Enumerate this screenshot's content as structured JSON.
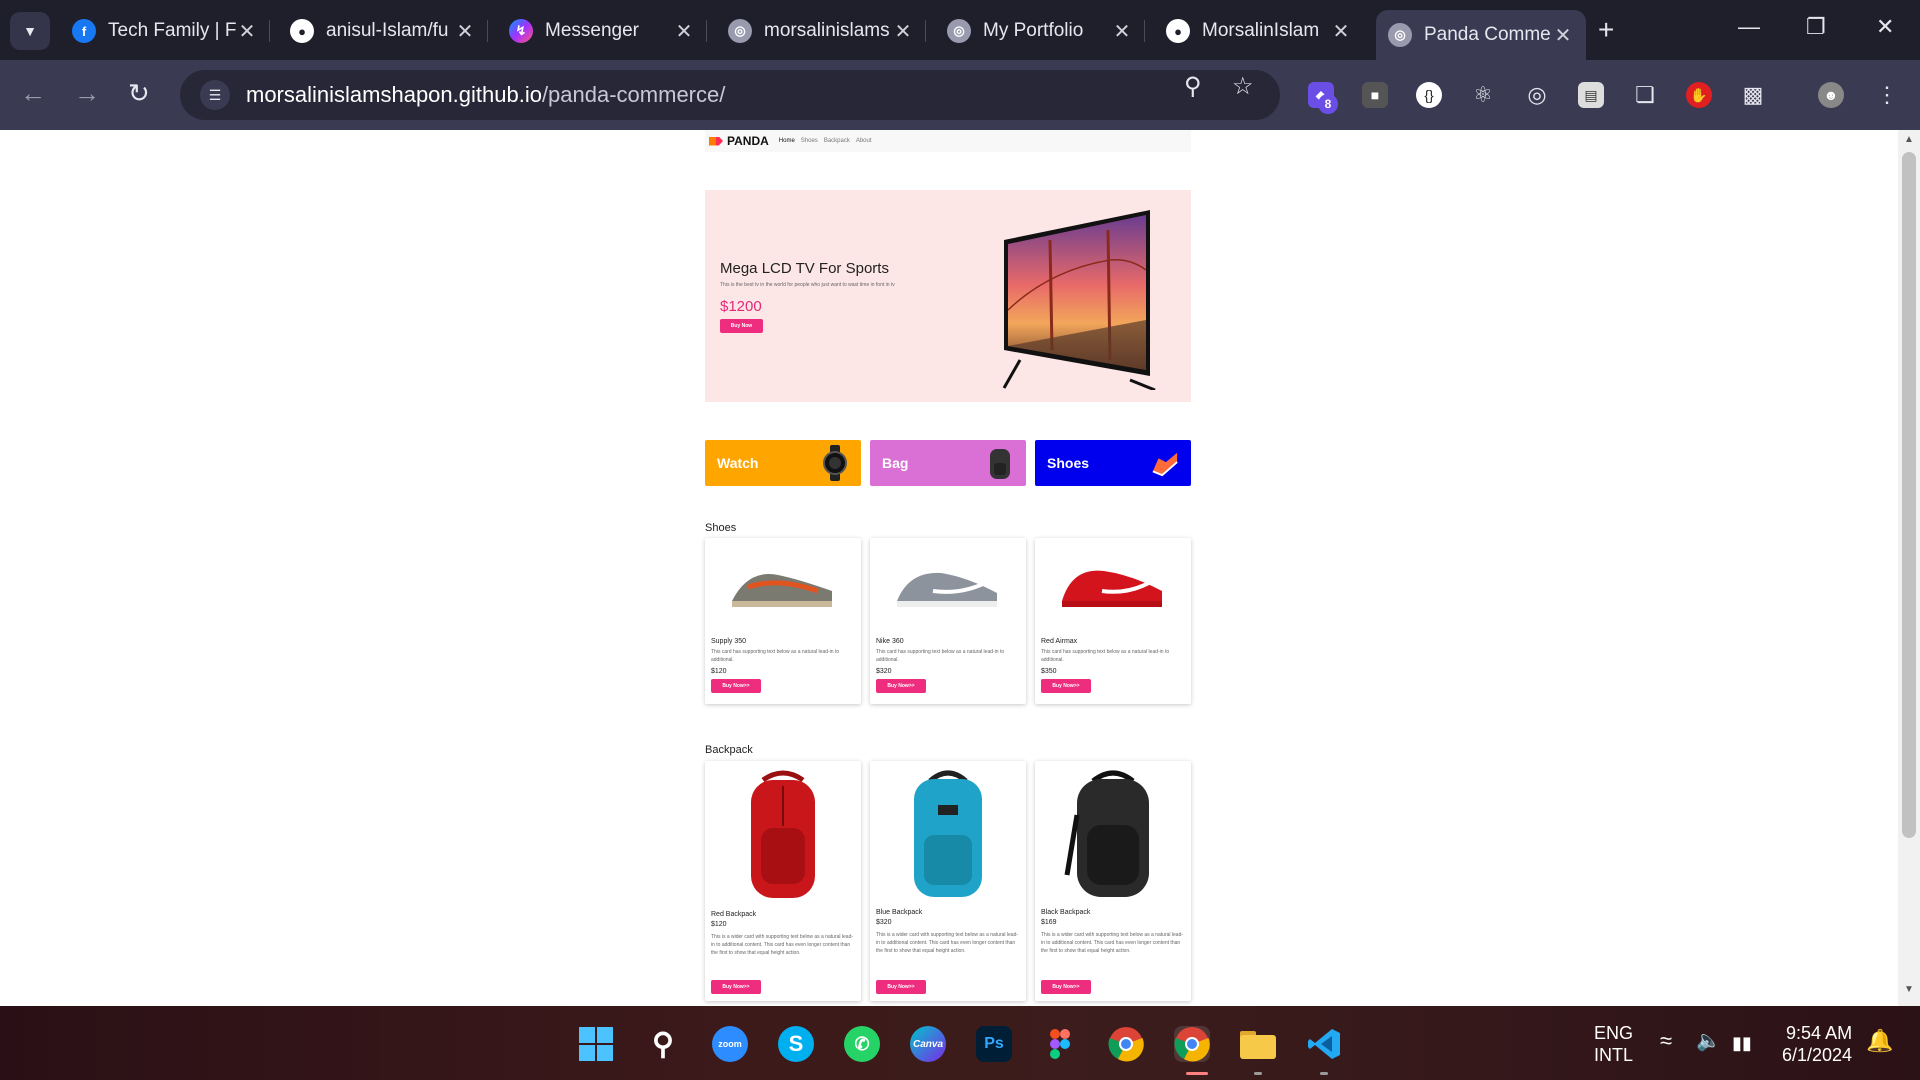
{
  "browser": {
    "tabs": [
      {
        "title": "Tech Family | F",
        "icon": "facebook-icon",
        "color": "#1877f2"
      },
      {
        "title": "anisul-Islam/fu",
        "icon": "github-icon",
        "color": "#ffffff"
      },
      {
        "title": "Messenger",
        "icon": "messenger-icon",
        "color": "#a033ff"
      },
      {
        "title": "morsalinislams",
        "icon": "globe-icon",
        "color": "#9a9aae"
      },
      {
        "title": "My Portfolio",
        "icon": "globe-icon",
        "color": "#9a9aae"
      },
      {
        "title": "MorsalinIslam",
        "icon": "github-icon",
        "color": "#ffffff"
      },
      {
        "title": "Panda Comme",
        "icon": "globe-icon",
        "color": "#9a9aae"
      }
    ],
    "url_domain": "morsalinislamshapon.github.io",
    "url_path": "/panda-commerce/",
    "extension_badge": "8"
  },
  "site": {
    "logo": "PANDA",
    "nav": [
      "Home",
      "Shoes",
      "Backpack",
      "About"
    ],
    "hero": {
      "title": "Mega LCD TV For Sports",
      "description": "This is the best tv in the world for people who just want to wast time in font in tv",
      "price": "$1200",
      "button": "Buy Now"
    },
    "categories": [
      {
        "label": "Watch",
        "color": "#ffa500",
        "icon": "watch-icon"
      },
      {
        "label": "Bag",
        "color": "#da70d6",
        "icon": "backpack-icon"
      },
      {
        "label": "Shoes",
        "color": "#0000ee",
        "icon": "sneaker-icon"
      }
    ],
    "shoes_section": {
      "title": "Shoes",
      "items": [
        {
          "name": "Supply 350",
          "description": "This card has supporting text below as a natural lead-in to additional.",
          "price": "$120",
          "button": "Buy Now>>"
        },
        {
          "name": "Nike 360",
          "description": "This card has supporting text below as a natural lead-in to additional.",
          "price": "$320",
          "button": "Buy Now>>"
        },
        {
          "name": "Red Airmax",
          "description": "This card has supporting text below as a natural lead-in to additional.",
          "price": "$350",
          "button": "Buy Now>>"
        }
      ]
    },
    "backpack_section": {
      "title": "Backpack",
      "items": [
        {
          "name": "Red Backpack",
          "price": "$120",
          "description": "This is a wider card with supporting text below as a natural lead-in to additional content. This card has even longer content than the first to show that equal height action.",
          "button": "Buy Now>>"
        },
        {
          "name": "Blue Backpack",
          "price": "$320",
          "description": "This is a wider card with supporting text below as a natural lead-in to additional content. This card has even longer content than the first to show that equal height action.",
          "button": "Buy Now>>"
        },
        {
          "name": "Black Backpack",
          "price": "$169",
          "description": "This is a wider card with supporting text below as a natural lead-in to additional content. This card has even longer content than the first to show that equal height action.",
          "button": "Buy Now>>"
        }
      ]
    }
  },
  "taskbar": {
    "apps": [
      "windows-start-icon",
      "search-icon",
      "zoom-icon",
      "skype-icon",
      "whatsapp-icon",
      "canva-icon",
      "photoshop-icon",
      "figma-icon",
      "chrome-icon",
      "chrome-profile-icon",
      "file-explorer-icon",
      "vscode-icon"
    ],
    "zoom_label": "zoom",
    "canva_label": "Canva",
    "ps_label": "Ps",
    "lang_line1": "ENG",
    "lang_line2": "INTL",
    "time": "9:54 AM",
    "date": "6/1/2024"
  }
}
